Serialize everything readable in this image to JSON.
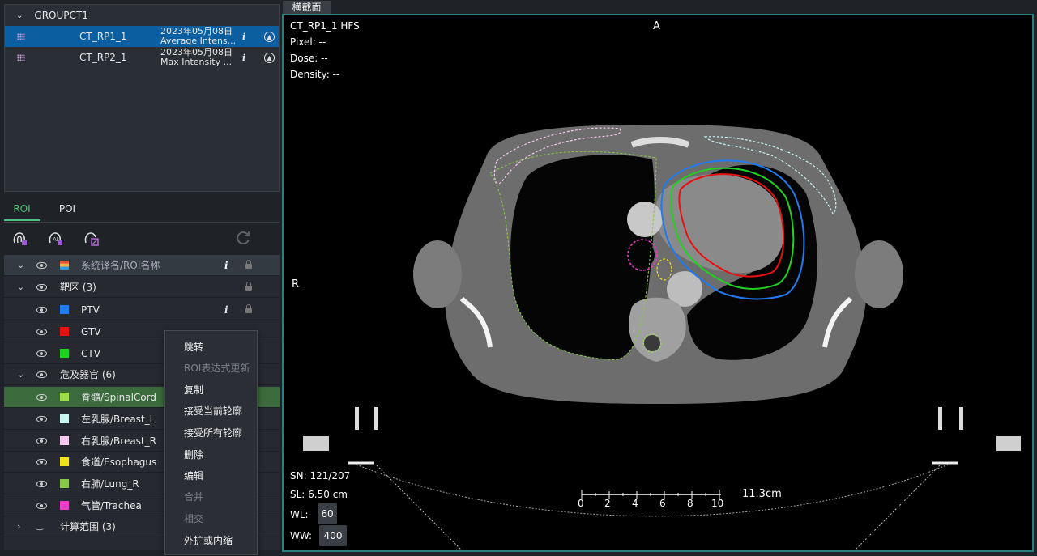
{
  "series_panel": {
    "group_label": "GROUPCT1",
    "series": [
      {
        "name": "CT_RP1_1",
        "date": "2023年05月08日",
        "desc": "Average Intens...",
        "info": "i",
        "selected": true
      },
      {
        "name": "CT_RP2_1",
        "date": "2023年05月08日",
        "desc": "Max Intensity ...",
        "info": "i",
        "selected": false
      }
    ]
  },
  "tabs": [
    "ROI",
    "POI"
  ],
  "roi_table": {
    "header_label": "系统译名/ROI名称",
    "header_info": "i",
    "categories": [
      {
        "label": "靶区 (3)"
      },
      {
        "label": "危及器官 (6)"
      },
      {
        "label": "计算范围 (3)"
      }
    ],
    "targets": [
      {
        "label": "PTV",
        "color": "#1e7bf0",
        "info": "i"
      },
      {
        "label": "GTV",
        "color": "#e81010"
      },
      {
        "label": "CTV",
        "color": "#1fd21f"
      }
    ],
    "oars": [
      {
        "label": "脊髓/SpinalCord",
        "color": "#9be04a"
      },
      {
        "label": "左乳腺/Breast_L",
        "color": "#c8f4f4"
      },
      {
        "label": "右乳腺/Breast_R",
        "color": "#f4c8ec"
      },
      {
        "label": "食道/Esophagus",
        "color": "#f0e21a"
      },
      {
        "label": "右肺/Lung_R",
        "color": "#8ac84a"
      },
      {
        "label": "气管/Trachea",
        "color": "#f03cc8"
      }
    ]
  },
  "context_menu": {
    "items": [
      {
        "label": "跳转",
        "enabled": true
      },
      {
        "label": "ROI表达式更新",
        "enabled": false
      },
      {
        "label": "复制",
        "enabled": true
      },
      {
        "label": "接受当前轮廓",
        "enabled": true
      },
      {
        "label": "接受所有轮廓",
        "enabled": true
      },
      {
        "label": "删除",
        "enabled": true
      },
      {
        "label": "编辑",
        "enabled": true
      },
      {
        "label": "合并",
        "enabled": false
      },
      {
        "label": "相交",
        "enabled": false
      },
      {
        "label": "外扩或内缩",
        "enabled": true
      }
    ]
  },
  "viewer": {
    "tab_label": "横截面",
    "series_label": "CT_RP1_1 HFS",
    "pixel_label": "Pixel: --",
    "dose_label": "Dose: --",
    "density_label": "Density: --",
    "orientation_top": "A",
    "orientation_left": "R",
    "sn_label": "SN: 121/207",
    "sl_label": "SL: 6.50 cm",
    "wl_label": "WL:",
    "wl_value": "60",
    "ww_label": "WW:",
    "ww_value": "400",
    "scale_ticks": [
      "0",
      "2",
      "4",
      "6",
      "8",
      "10"
    ],
    "scale_length": "11.3cm"
  }
}
